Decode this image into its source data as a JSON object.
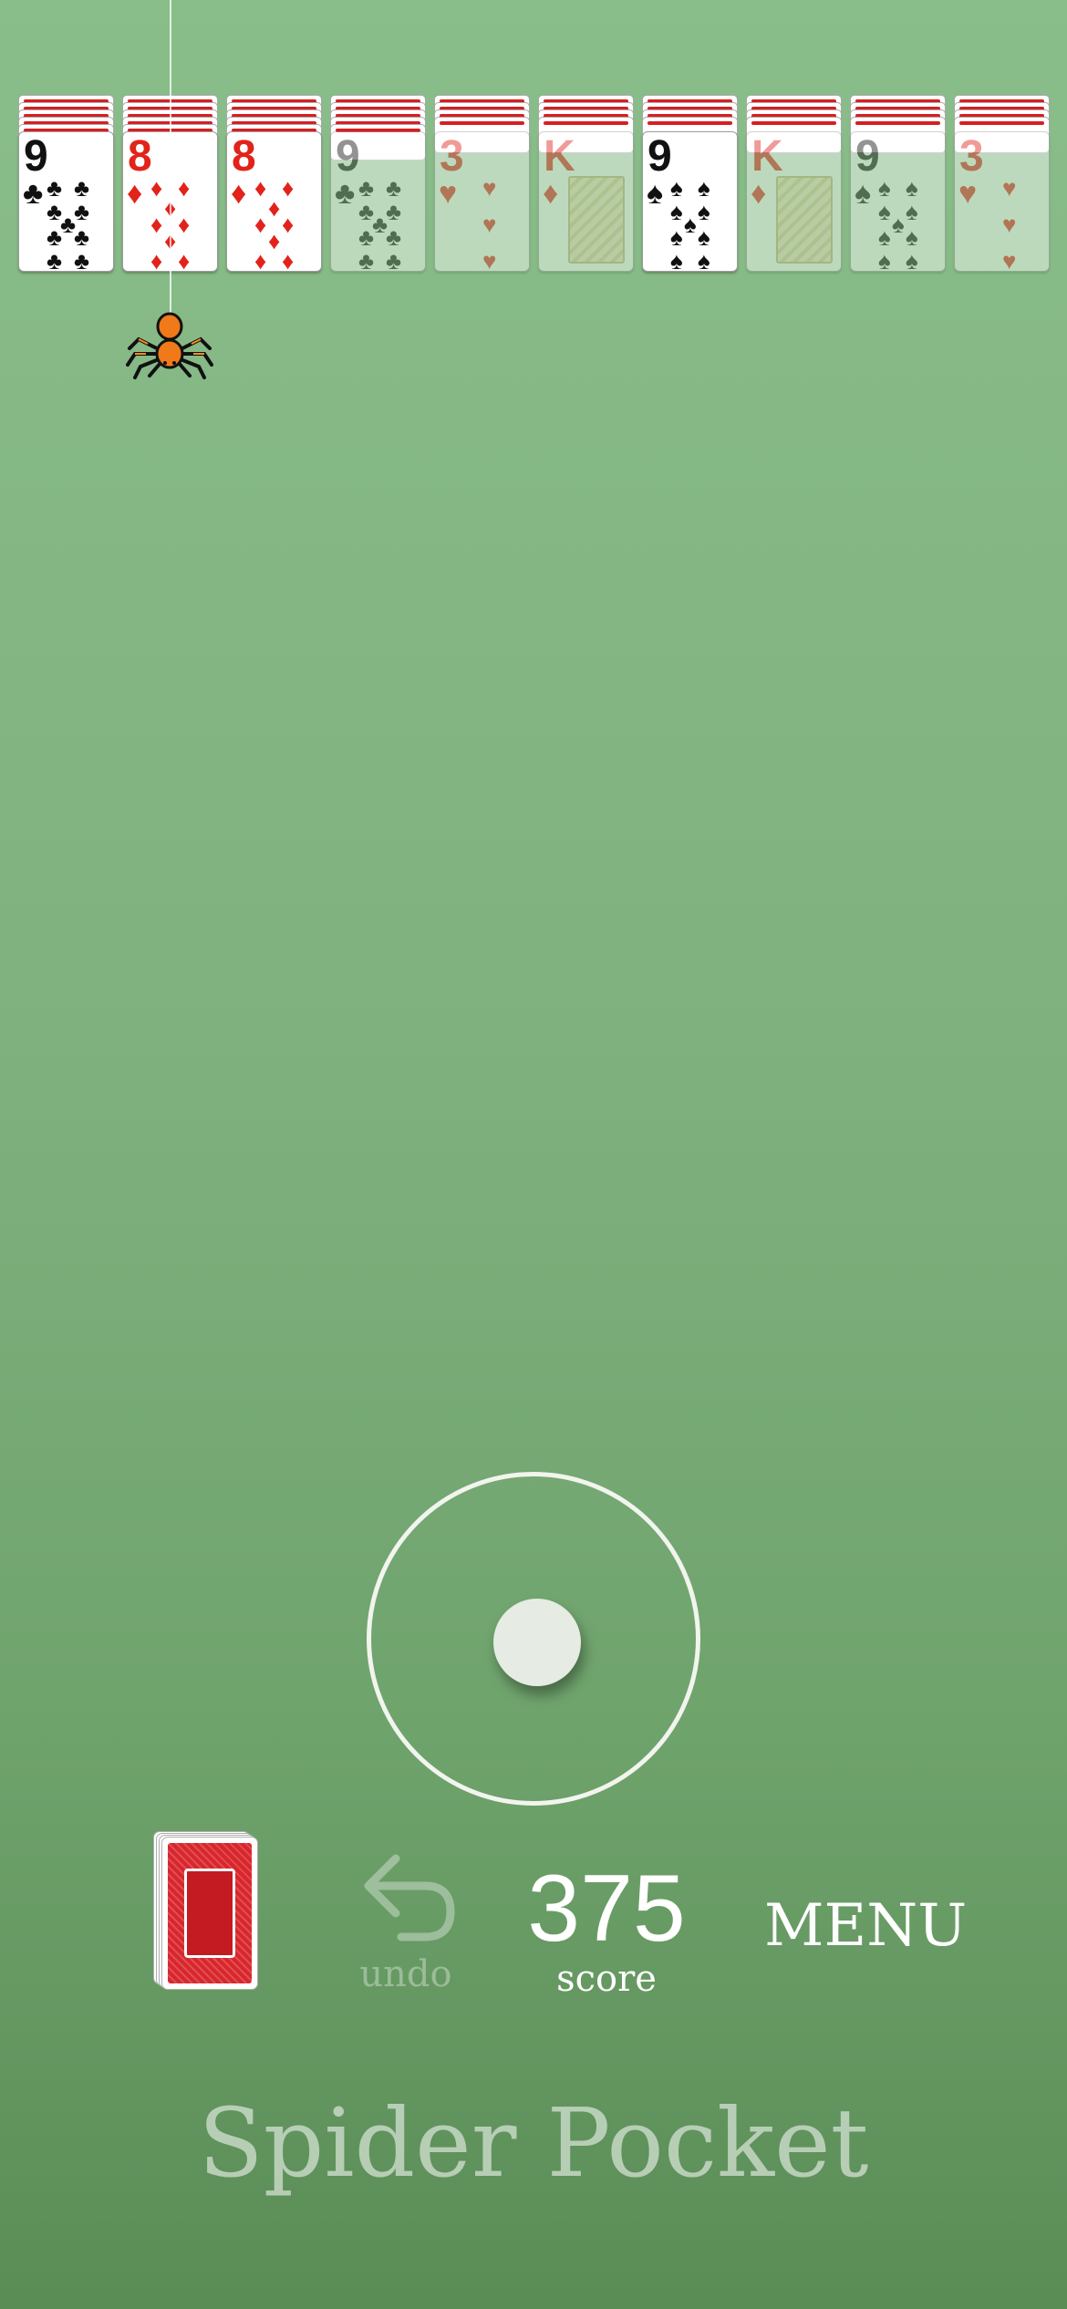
{
  "app": {
    "title": "Spider Pocket"
  },
  "colors": {
    "felt": "#85b885",
    "card_back": "#d61f23",
    "suit_red": "#e2231a",
    "suit_black": "#111111"
  },
  "tableau": [
    {
      "facedown": 5,
      "top": {
        "rank": "9",
        "suit": "clubs",
        "glyph": "♣",
        "color": "black",
        "dimmed": false
      }
    },
    {
      "facedown": 5,
      "top": {
        "rank": "8",
        "suit": "diamonds",
        "glyph": "♦",
        "color": "red",
        "dimmed": false
      }
    },
    {
      "facedown": 5,
      "top": {
        "rank": "8",
        "suit": "diamonds",
        "glyph": "♦",
        "color": "red",
        "dimmed": false
      }
    },
    {
      "facedown": 5,
      "top": {
        "rank": "9",
        "suit": "clubs",
        "glyph": "♣",
        "color": "black",
        "dimmed": true
      }
    },
    {
      "facedown": 4,
      "top": {
        "rank": "3",
        "suit": "hearts",
        "glyph": "♥",
        "color": "red",
        "dimmed": true
      }
    },
    {
      "facedown": 4,
      "top": {
        "rank": "K",
        "suit": "diamonds",
        "glyph": "♦",
        "color": "red",
        "dimmed": true
      }
    },
    {
      "facedown": 4,
      "top": {
        "rank": "9",
        "suit": "spades",
        "glyph": "♠",
        "color": "black",
        "dimmed": false
      }
    },
    {
      "facedown": 4,
      "top": {
        "rank": "K",
        "suit": "diamonds",
        "glyph": "♦",
        "color": "red",
        "dimmed": true
      }
    },
    {
      "facedown": 4,
      "top": {
        "rank": "9",
        "suit": "spades",
        "glyph": "♠",
        "color": "black",
        "dimmed": true
      }
    },
    {
      "facedown": 4,
      "top": {
        "rank": "3",
        "suit": "hearts",
        "glyph": "♥",
        "color": "red",
        "dimmed": true
      }
    }
  ],
  "stock": {
    "stack_depth": 4,
    "icon": "card-back-stack-icon"
  },
  "controls": {
    "undo_label": "undo",
    "undo_enabled": false,
    "score_value": "375",
    "score_label": "score",
    "menu_label": "MENU"
  },
  "icons": {
    "spider": "spider-icon",
    "undo": "undo-arrow-icon",
    "joystick": "joystick-knob"
  }
}
